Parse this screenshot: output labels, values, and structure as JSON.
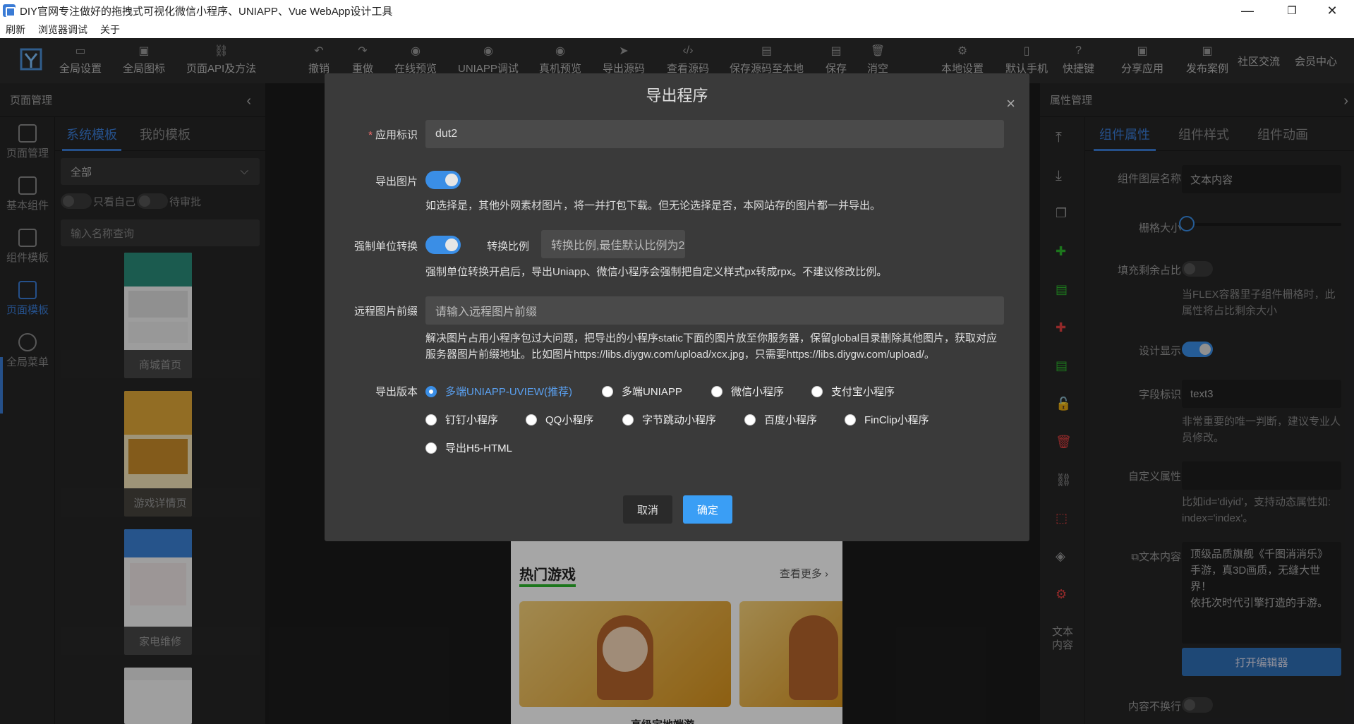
{
  "window": {
    "title": "DIY官网专注做好的拖拽式可视化微信小程序、UNIAPP、Vue WebApp设计工具",
    "minimize": "—",
    "maximize": "❐",
    "close": "✕"
  },
  "menubar": [
    "刷新",
    "浏览器调试",
    "关于"
  ],
  "toolbar": {
    "items": [
      "全局设置",
      "全局图标",
      "页面API及方法",
      "撤销",
      "重做",
      "在线预览",
      "UNIAPP调试",
      "真机预览",
      "导出源码",
      "查看源码",
      "保存源码至本地",
      "保存",
      "消空",
      "本地设置",
      "默认手机",
      "快捷键",
      "分享应用",
      "发布案例"
    ],
    "links": [
      "社区交流",
      "会员中心"
    ]
  },
  "left_panel": {
    "title": "页面管理",
    "rail": [
      "页面管理",
      "基本组件",
      "组件模板",
      "页面模板",
      "全局菜单"
    ],
    "tabs": [
      "系统模板",
      "我的模板"
    ],
    "filter_value": "全部",
    "toggle_mine": "只看自己",
    "toggle_pending": "待审批",
    "search_placeholder": "输入名称查询",
    "templates": [
      "商城首页",
      "游戏详情页",
      "家电维修",
      ""
    ]
  },
  "canvas": {
    "section_title": "热门游戏",
    "more": "查看更多 ›",
    "caption": "高级定地端游"
  },
  "right_panel": {
    "title": "属性管理",
    "tabs": [
      "组件属性",
      "组件样式",
      "组件动画"
    ],
    "rail_bottom_label": "文本内容",
    "props": {
      "layer_name_label": "组件图层名称",
      "layer_name_value": "文本内容",
      "grid_label": "栅格大小",
      "fill_label": "填充剩余占比",
      "fill_hint": "当FLEX容器里子组件栅格时，此属性将占比剩余大小",
      "design_label": "设计显示",
      "field_label": "字段标识",
      "field_value": "text3",
      "field_hint": "非常重要的唯一判断，建议专业人员修改。",
      "custom_label": "自定义属性",
      "custom_hint": "比如id='diyid'，支持动态属性如: index='index'。",
      "text_label": "文本内容",
      "text_value": "顶级品质旗舰《千图消消乐》手游，真3D画质，无缝大世界！\n依托次时代引擎打造的手游。",
      "editor_button": "打开编辑器",
      "nowrap_label": "内容不换行"
    }
  },
  "modal": {
    "title": "导出程序",
    "close": "×",
    "app_id_label": "应用标识",
    "app_id_value": "dut2",
    "export_images_label": "导出图片",
    "export_images_hint": "如选择是，其他外网素材图片，将一并打包下载。但无论选择是否，本网站存的图片都一并导出。",
    "force_unit_label": "强制单位转换",
    "ratio_label": "转换比例",
    "ratio_placeholder": "转换比例,最佳默认比例为2",
    "force_unit_hint": "强制单位转换开启后，导出Uniapp、微信小程序会强制把自定义样式px转成rpx。不建议修改比例。",
    "remote_prefix_label": "远程图片前缀",
    "remote_prefix_placeholder": "请输入远程图片前缀",
    "remote_prefix_hint": "解决图片占用小程序包过大问题，把导出的小程序static下面的图片放至你服务器，保留global目录删除其他图片，获取对应服务器图片前缀地址。比如图片https://libs.diygw.com/upload/xcx.jpg，只需要https://libs.diygw.com/upload/。",
    "version_label": "导出版本",
    "versions": [
      "多端UNIAPP-UVIEW(推荐)",
      "多端UNIAPP",
      "微信小程序",
      "支付宝小程序",
      "钉钉小程序",
      "QQ小程序",
      "字节跳动小程序",
      "百度小程序",
      "FinClip小程序",
      "导出H5-HTML"
    ],
    "selected_version": "多端UNIAPP-UVIEW(推荐)",
    "cancel_button": "取消",
    "ok_button": "确定"
  },
  "colors": {
    "accent": "#3a8ee6",
    "required": "#f56c6c"
  }
}
